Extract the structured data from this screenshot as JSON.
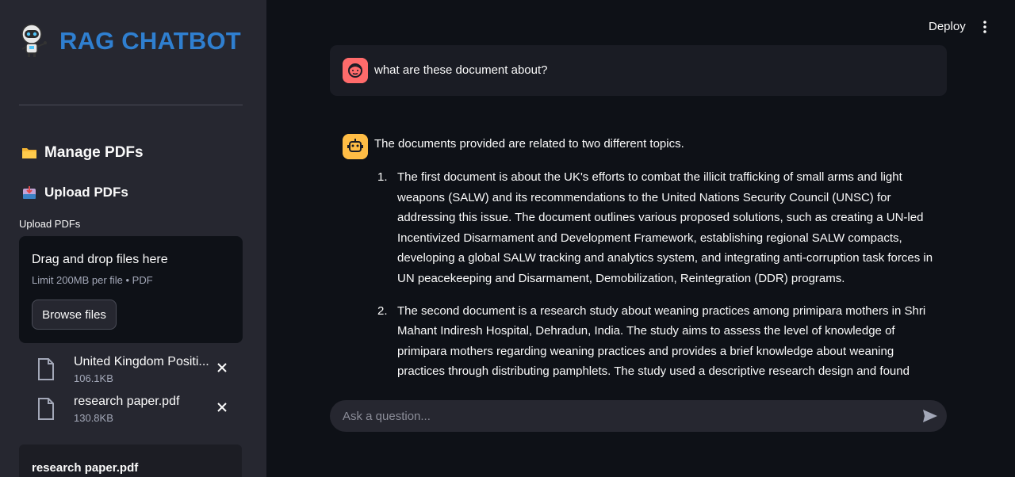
{
  "app": {
    "title": "RAG CHATBOT",
    "accent_color": "#2f7fd0",
    "logo_icon": "robot-icon"
  },
  "sidebar": {
    "manage_heading": "Manage PDFs",
    "manage_icon": "folder-icon",
    "upload_heading": "Upload PDFs",
    "upload_icon": "inbox-tray-icon",
    "uploader_label": "Upload PDFs",
    "dropzone": {
      "title": "Drag and drop files here",
      "subtitle": "Limit 200MB per file • PDF",
      "browse_label": "Browse files"
    },
    "files": [
      {
        "name": "United Kingdom Positi...",
        "size": "106.1KB"
      },
      {
        "name": "research paper.pdf",
        "size": "130.8KB"
      }
    ],
    "preview_title": "research paper.pdf"
  },
  "header": {
    "deploy_label": "Deploy",
    "menu_icon": "more-vertical-icon"
  },
  "chat": {
    "user_message": "what are these document about?",
    "assistant_intro": "The documents provided are related to two different topics.",
    "assistant_points": [
      "The first document is about the UK's efforts to combat the illicit trafficking of small arms and light weapons (SALW) and its recommendations to the United Nations Security Council (UNSC) for addressing this issue. The document outlines various proposed solutions, such as creating a UN-led Incentivized Disarmament and Development Framework, establishing regional SALW compacts, developing a global SALW tracking and analytics system, and integrating anti-corruption task forces in UN peacekeeping and Disarmament, Demobilization, Reintegration (DDR) programs.",
      "The second document is a research study about weaning practices among primipara mothers in Shri Mahant Indiresh Hospital, Dehradun, India. The study aims to assess the level of knowledge of primipara mothers regarding weaning practices and provides a brief knowledge about weaning practices through distributing pamphlets. The study used a descriptive research design and found"
    ],
    "numbers": [
      "1.",
      "2."
    ],
    "input_placeholder": "Ask a question...",
    "user_avatar_color": "#ff6b6b",
    "assistant_avatar_color": "#ffbd45"
  }
}
